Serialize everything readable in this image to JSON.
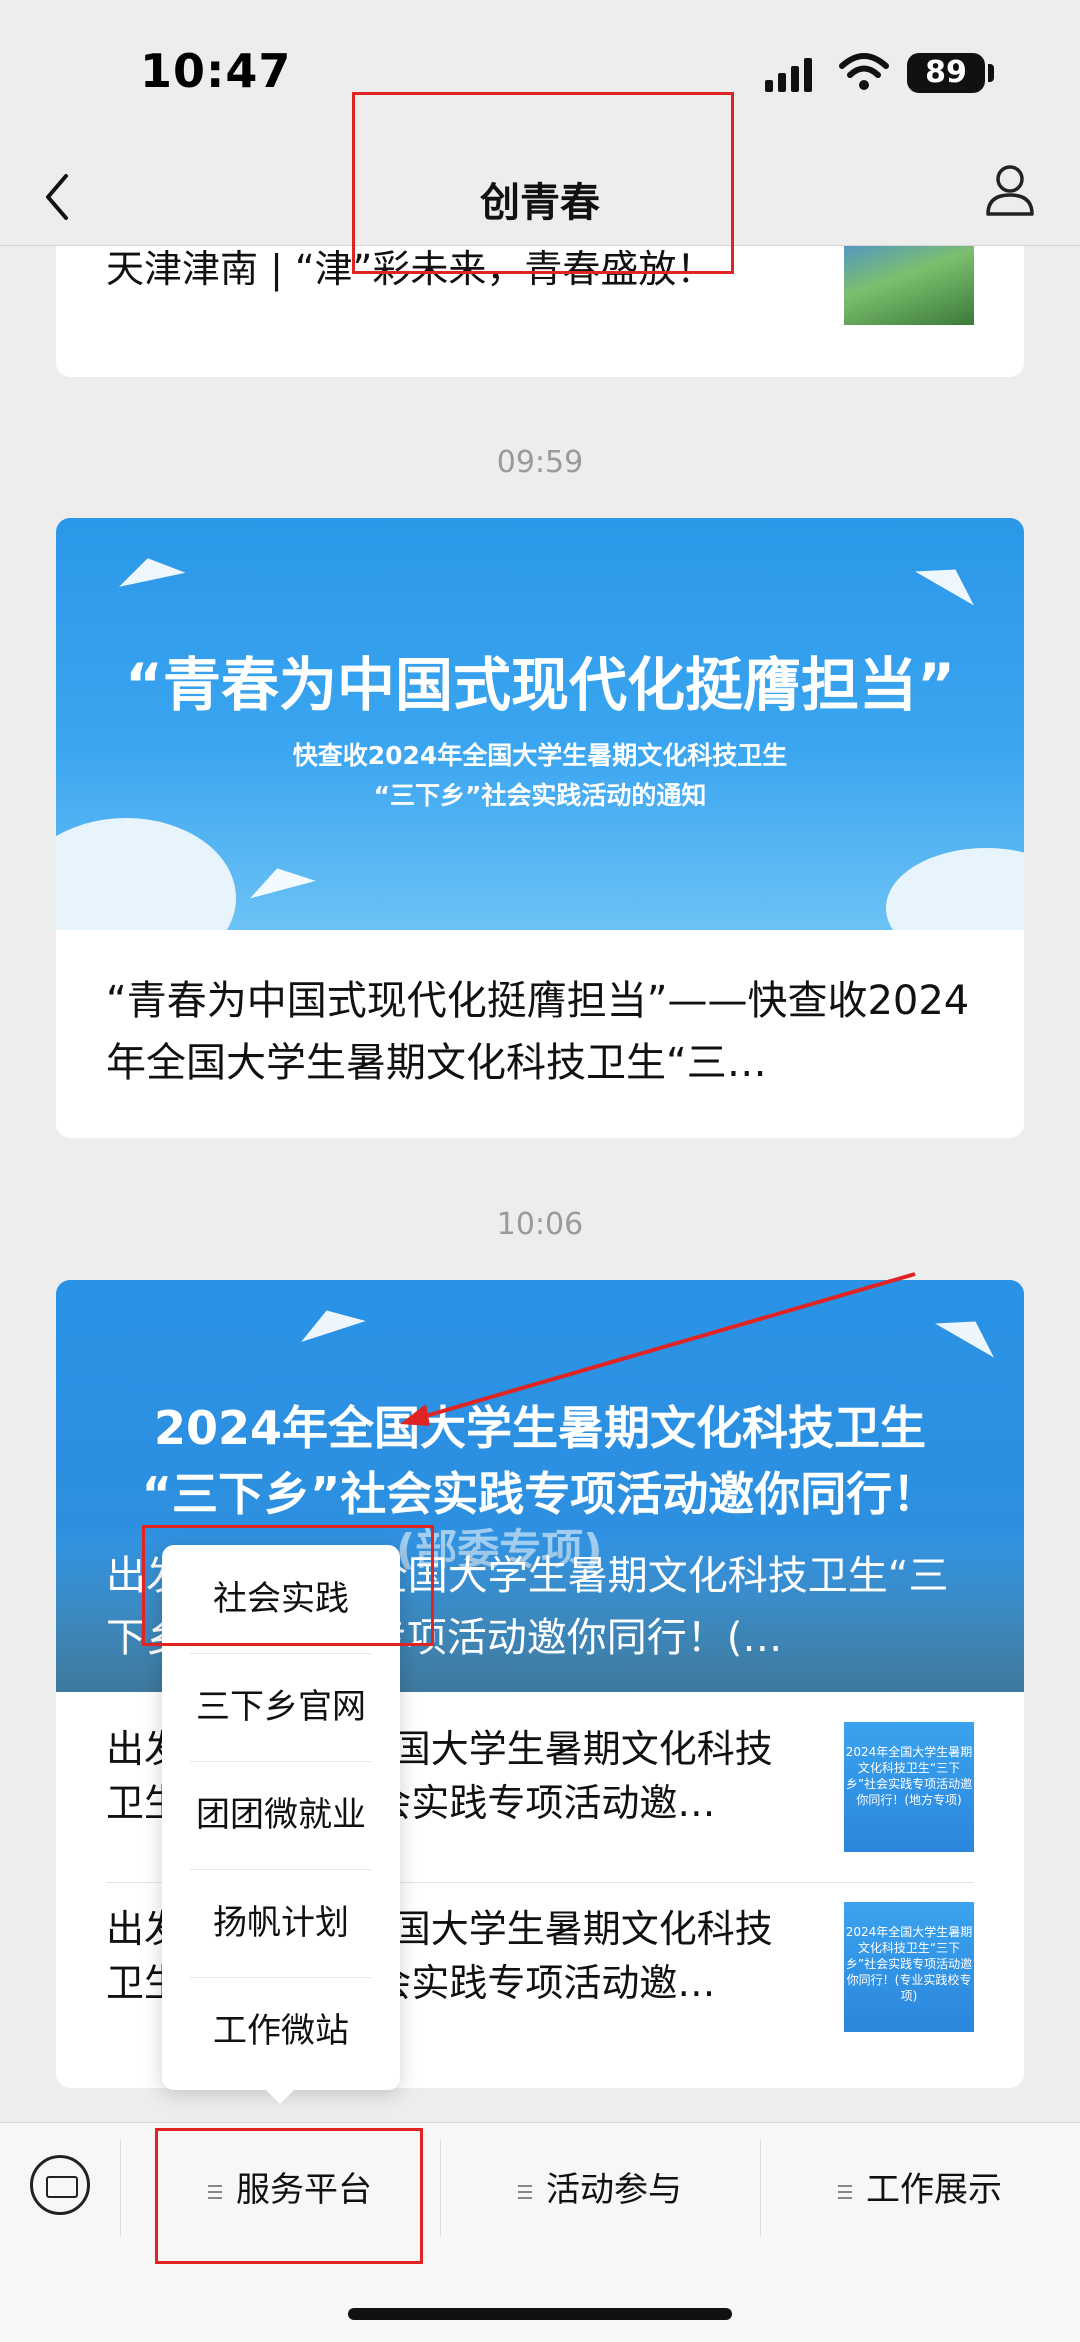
{
  "status_bar": {
    "time": "10:47",
    "battery": "89"
  },
  "nav": {
    "title": "创青春"
  },
  "feed": {
    "card1": {
      "title": "天津津南 | “津”彩未来，青春盛放！"
    },
    "timestamp2": "09:59",
    "card2": {
      "banner_main": "“青春为中国式现代化挺膺担当”",
      "banner_sub1": "快查收2024年全国大学生暑期文化科技卫生",
      "banner_sub2": "“三下乡”社会实践活动的通知",
      "title": "“青春为中国式现代化挺膺担当”——快查收2024年全国大学生暑期文化科技卫生“三…"
    },
    "timestamp3": "10:06",
    "card3": {
      "banner_line1": "2024年全国大学生暑期文化科技卫生",
      "banner_line2": "“三下乡”社会实践专项活动邀你同行！",
      "banner_line3": "(部委专项)",
      "banner_title": "出发！2024年全国大学生暑期文化科技卫生“三下乡”社会实践专项活动邀你同行！(…",
      "items": [
        {
          "title": "出发！2024年全国大学生暑期文化科技卫生“三下乡”社会实践专项活动邀…",
          "thumb_text": "2024年全国大学生暑期文化科技卫生“三下乡”社会实践专项活动邀你同行！(地方专项)"
        },
        {
          "title": "出发！2024年全国大学生暑期文化科技卫生“三下乡”社会实践专项活动邀…",
          "thumb_text": "2024年全国大学生暑期文化科技卫生“三下乡”社会实践专项活动邀你同行！(专业实践校专项)"
        }
      ]
    }
  },
  "popup_menu": {
    "items": [
      "社会实践",
      "三下乡官网",
      "团团微就业",
      "扬帆计划",
      "工作微站"
    ]
  },
  "bottom_menu": {
    "items": [
      "服务平台",
      "活动参与",
      "工作展示"
    ]
  },
  "colors": {
    "annotation_red": "#e02424",
    "banner_blue": "#2b97e8"
  }
}
